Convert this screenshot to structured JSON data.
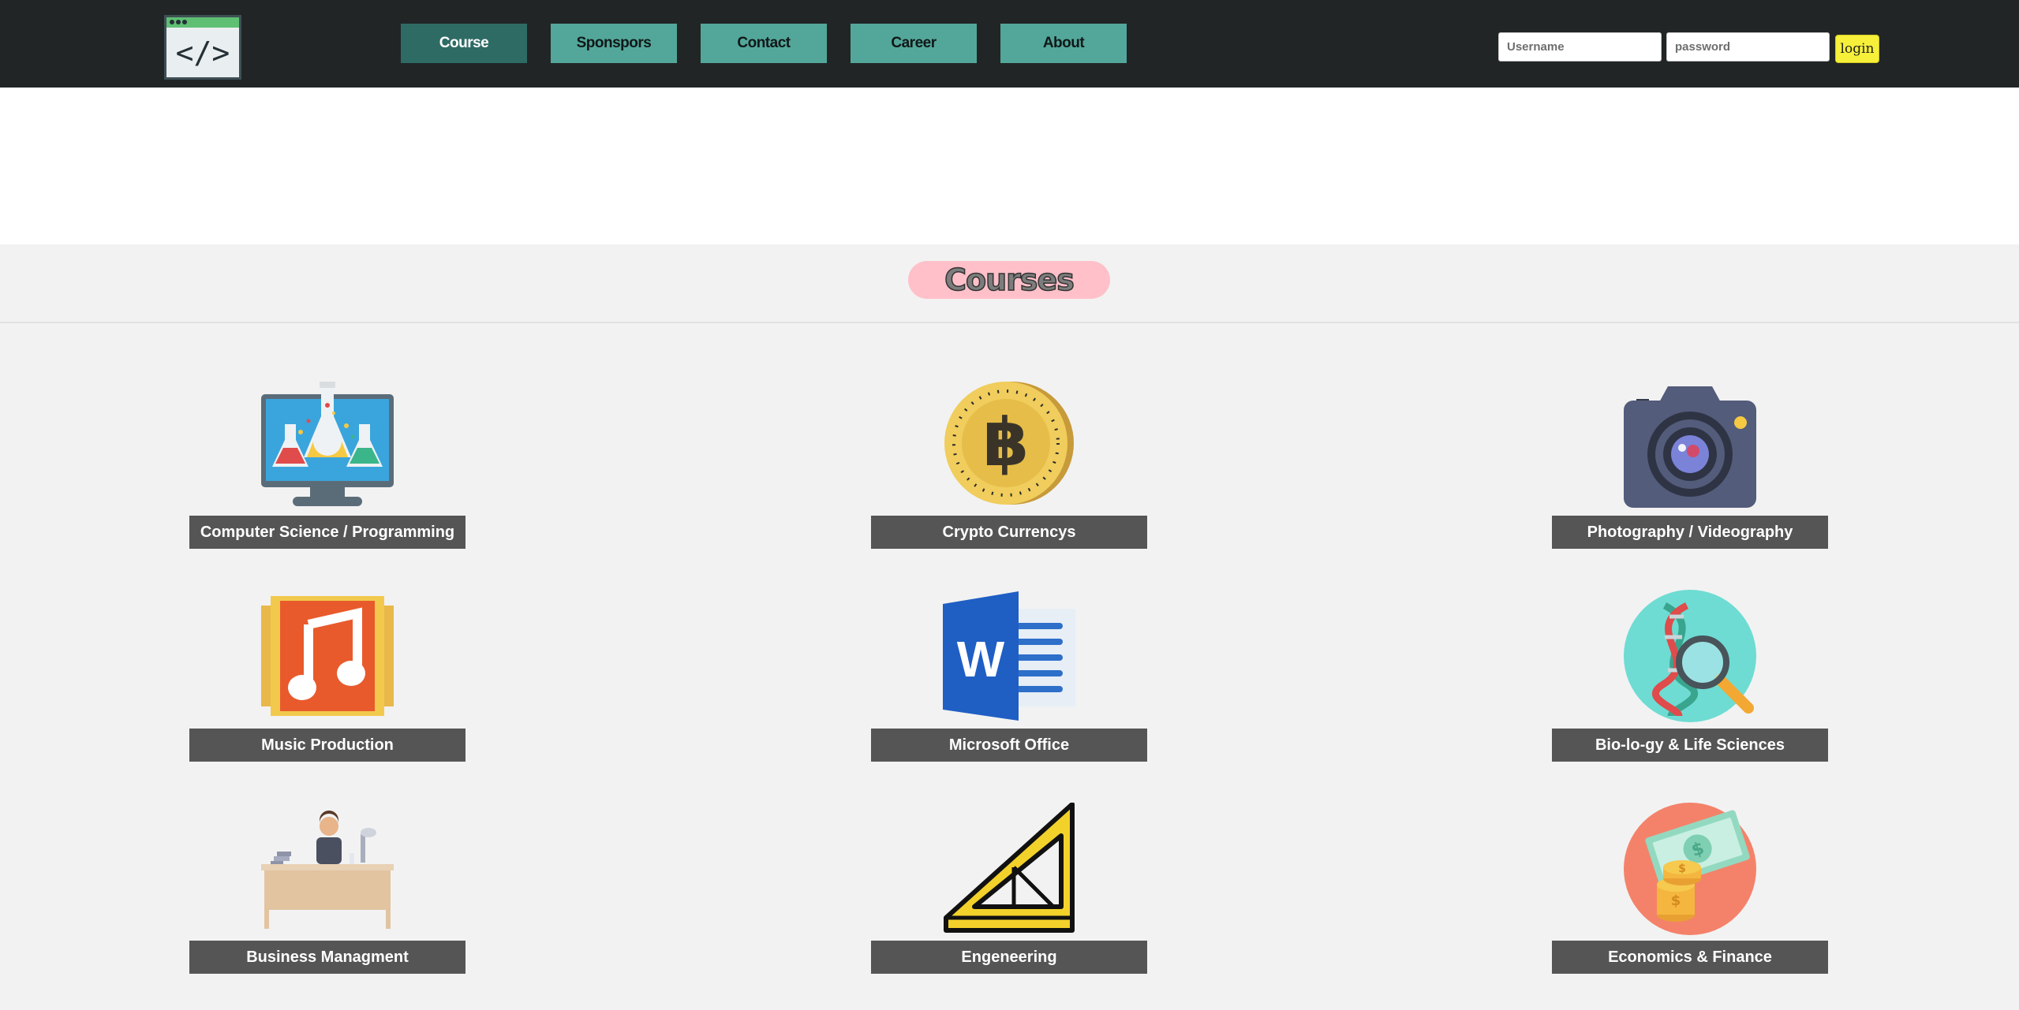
{
  "header": {
    "logo_icon": "code-window-icon",
    "logo_text": "</>",
    "nav": [
      {
        "label": "Course",
        "active": true
      },
      {
        "label": "Sponspors",
        "active": false
      },
      {
        "label": "Contact",
        "active": false
      },
      {
        "label": "Career",
        "active": false
      },
      {
        "label": "About",
        "active": false
      }
    ],
    "login": {
      "username_placeholder": "Username",
      "password_placeholder": "password",
      "button_label": "login"
    }
  },
  "main": {
    "section_title": "Courses",
    "courses": [
      {
        "label": "Computer Science / Programming",
        "icon": "computer-lab-icon"
      },
      {
        "label": "Crypto Currencys",
        "icon": "bitcoin-icon"
      },
      {
        "label": "Photography / Videography",
        "icon": "camera-icon"
      },
      {
        "label": "Music Production",
        "icon": "music-note-icon"
      },
      {
        "label": "Microsoft Office",
        "icon": "word-document-icon"
      },
      {
        "label": "Bio-lo-gy & Life Sciences",
        "icon": "dna-magnifier-icon"
      },
      {
        "label": "Business Managment",
        "icon": "office-desk-icon"
      },
      {
        "label": "Engeneering",
        "icon": "set-square-icon"
      },
      {
        "label": "Economics & Finance",
        "icon": "money-coins-icon"
      }
    ]
  },
  "colors": {
    "topbar": "#212526",
    "nav_button": "#53a79a",
    "nav_button_active": "#2f6b65",
    "login_button": "#f6f03a",
    "section_title_bg": "#ffc0c9",
    "course_label_bg": "#555555"
  }
}
